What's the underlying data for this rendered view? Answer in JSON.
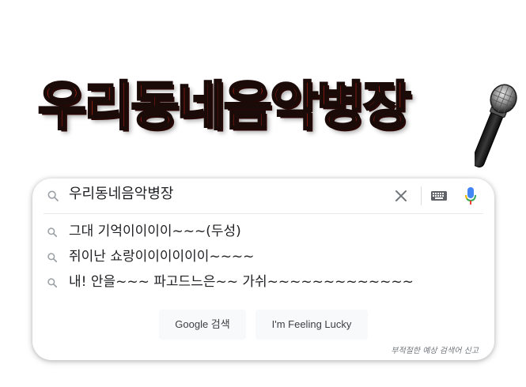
{
  "logo": {
    "text": "우리동네음악병장"
  },
  "search": {
    "query": "우리동네음악병장"
  },
  "suggestions": [
    {
      "text": "그대 기억이이이이~~~(두성)"
    },
    {
      "text": "쥐이난 쇼랑이이이이이이~~~~"
    },
    {
      "text": "내! 안을~~~ 파고드느은~~ 가쉬~~~~~~~~~~~~~"
    }
  ],
  "buttons": {
    "google_search": "Google 검색",
    "feeling_lucky": "I'm Feeling Lucky"
  },
  "report_link": "부적절한 예상 검색어 신고",
  "icons": {
    "search": "search-icon",
    "clear": "close-icon",
    "keyboard": "keyboard-icon",
    "voice": "microphone-icon",
    "logo_mic": "microphone-icon"
  },
  "colors": {
    "logo_red": "#ff2a1a",
    "mic_blue": "#4285f4",
    "mic_red": "#ea4335",
    "mic_yellow": "#fbbc04",
    "mic_green": "#34a853"
  }
}
